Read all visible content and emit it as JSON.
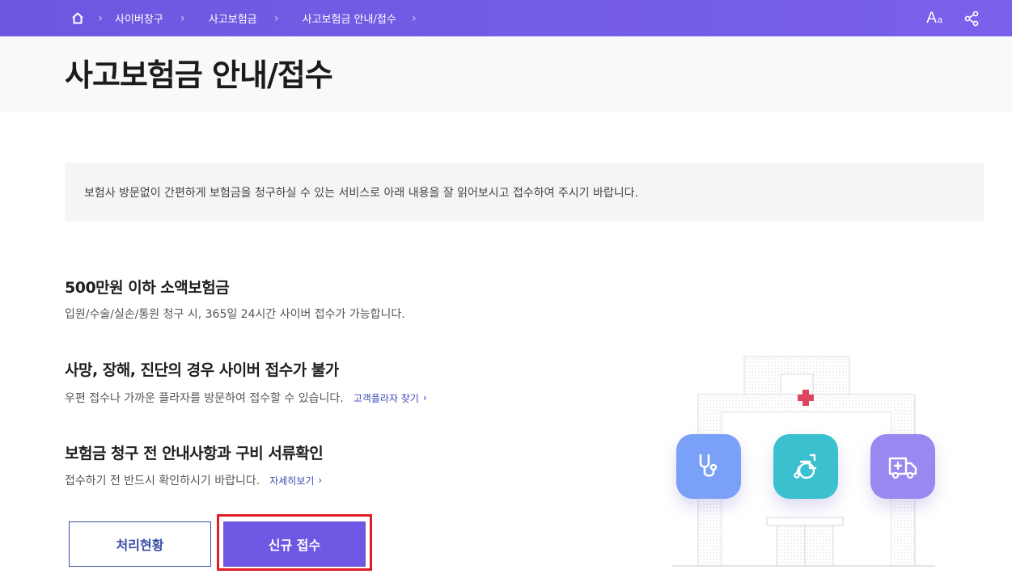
{
  "breadcrumb": {
    "items": [
      "사이버창구",
      "사고보험금",
      "사고보험금 안내/접수"
    ]
  },
  "header": {
    "font_size_label_big": "A",
    "font_size_label_small": "a"
  },
  "page": {
    "title": "사고보험금 안내/접수",
    "notice": "보험사 방문없이 간편하게 보험금을 청구하실 수 있는 서비스로 아래 내용을 잘 읽어보시고 접수하여 주시기 바랍니다."
  },
  "sections": [
    {
      "title": "500만원 이하 소액보험금",
      "desc": "입원/수술/실손/통원 청구 시, 365일 24시간 사이버 접수가 가능합니다."
    },
    {
      "title": "사망, 장해, 진단의 경우 사이버 접수가 불가",
      "desc": "우편 접수나 가까운 플라자를 방문하여 접수할 수 있습니다.",
      "link": "고객플라자 찾기"
    },
    {
      "title": "보험금 청구 전 안내사항과 구비 서류확인",
      "desc": "접수하기 전 반드시 확인하시기 바랍니다.",
      "link": "자세히보기"
    }
  ],
  "buttons": {
    "status": "처리현황",
    "new_claim": "신규 접수"
  },
  "icons": {
    "home": "home-icon",
    "share": "share-icon",
    "stethoscope": "stethoscope-icon",
    "wheelchair": "wheelchair-icon",
    "ambulance": "ambulance-icon"
  },
  "colors": {
    "nav": "#7059e6",
    "primary": "#6f56e3",
    "outline": "#3a4da5",
    "highlight": "#e01e24",
    "tile_blue": "#7aa0f7",
    "tile_teal": "#3bc0cf",
    "tile_purple": "#9b87f0",
    "cross": "#e0455f"
  }
}
